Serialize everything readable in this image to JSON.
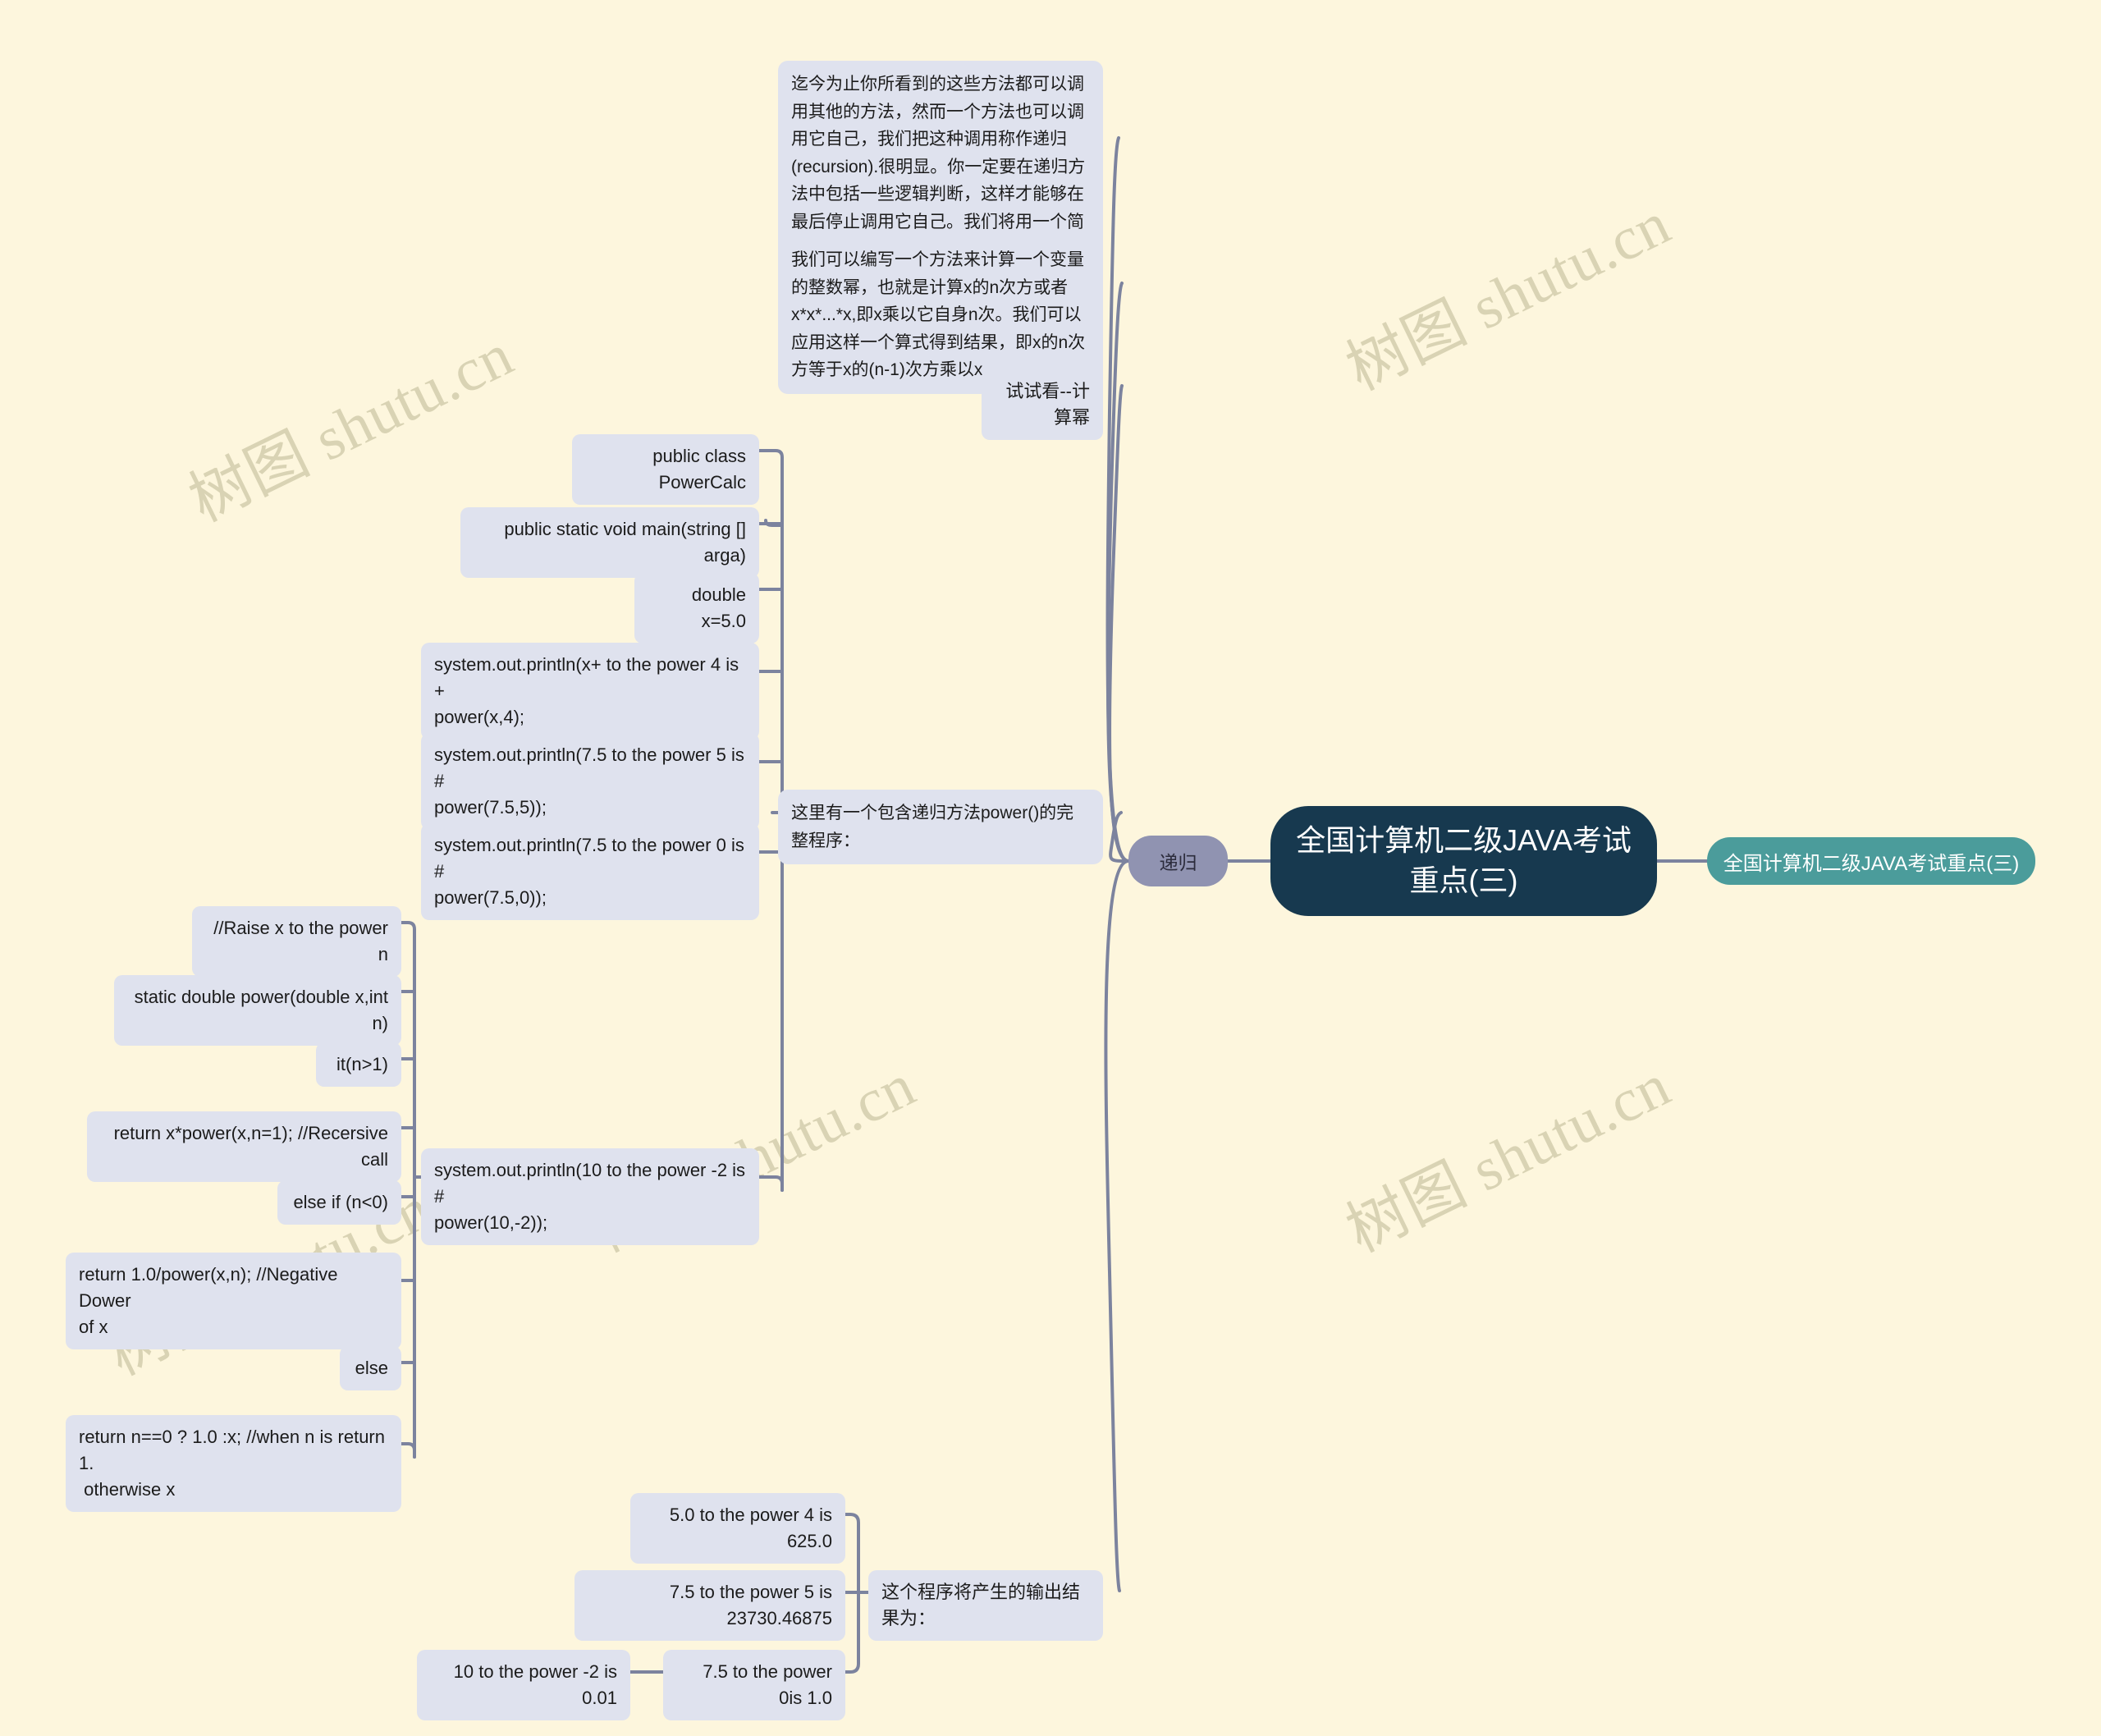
{
  "meta": {
    "background_color": "#fdf6dd",
    "node_color": "#dfe2ee",
    "central_color": "#17394f",
    "branch_color": "#9093b1",
    "accent_color": "#4b9c9b",
    "connector_color": "#7c839e",
    "watermark_text": "树图 shutu.cn"
  },
  "central": {
    "title": "全国计算机二级JAVA考试\n重点(三)"
  },
  "right_branch": {
    "label": "全国计算机二级JAVA考试重点(三)"
  },
  "left_branch": {
    "label": "递归"
  },
  "topics": {
    "intro_paragraph": "迄今为止你所看到的这些方法都可以调用其他的方法，然而一个方法也可以调用它自己，我们把这种调用称作递归(recursion).很明显。你一定要在递归方法中包括一些逻辑判断，这样才能够在最后停止调用它自己。我们将用一个简单的例子来介绍它的实现过程。",
    "power_paragraph": "我们可以编写一个方法来计算一个变量的整数幂，也就是计算x的n次方或者x*x*...*x,即x乘以它自身n次。我们可以应用这样一个算式得到结果，即x的n次方等于x的(n-1)次方乘以x.",
    "try_it": "试试看--计算幂",
    "full_program": "这里有一个包含递归方法power()的完整程序：",
    "output_header": "这个程序将产生的输出结果为："
  },
  "program_lines": [
    "public class PowerCalc",
    "public static void main(string [] arga)",
    "double x=5.0",
    "system.out.println(x+ to the power 4 is +\npower(x,4);",
    "system.out.println(7.5 to the power 5 is #\npower(7.5,5));",
    "system.out.println(7.5 to the power 0 is #\npower(7.5,0));",
    "system.out.println(10 to the power -2 is #\npower(10,-2));"
  ],
  "power_method_lines": [
    "//Raise x to the power n",
    "static double power(double x,int n)",
    "it(n>1)",
    "return x*power(x,n=1); //Recersive call",
    "else if (n<0)",
    "return 1.0/power(x,n); //Negative Dower\nof x",
    "else",
    "return n==0 ? 1.0 :x; //when n is return 1.\n otherwise x"
  ],
  "output_lines": [
    "5.0 to the power 4 is 625.0",
    "7.5 to the power 5 is 23730.46875",
    "7.5 to the power 0is 1.0",
    "10 to the power -2 is 0.01"
  ]
}
